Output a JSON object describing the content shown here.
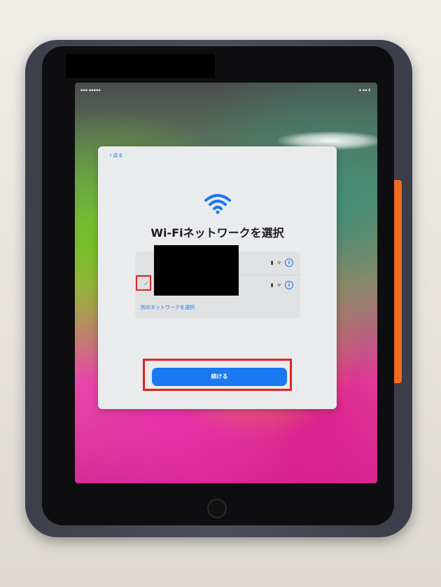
{
  "dialog": {
    "back_label": "戻る",
    "title": "Wi-Fiネットワークを選択",
    "other_network_label": "別のネットワークを選択",
    "continue_label": "続ける"
  },
  "networks": [
    {
      "selected": false,
      "secured": true
    },
    {
      "selected": true,
      "secured": true
    }
  ],
  "icons": {
    "selected_check": "✓",
    "lock": "🔒",
    "wifi_signal": "wifi",
    "info": "i"
  },
  "colors": {
    "accent": "#1a78f0",
    "highlight": "#e32222",
    "dialog_bg": "#e9ebec"
  }
}
